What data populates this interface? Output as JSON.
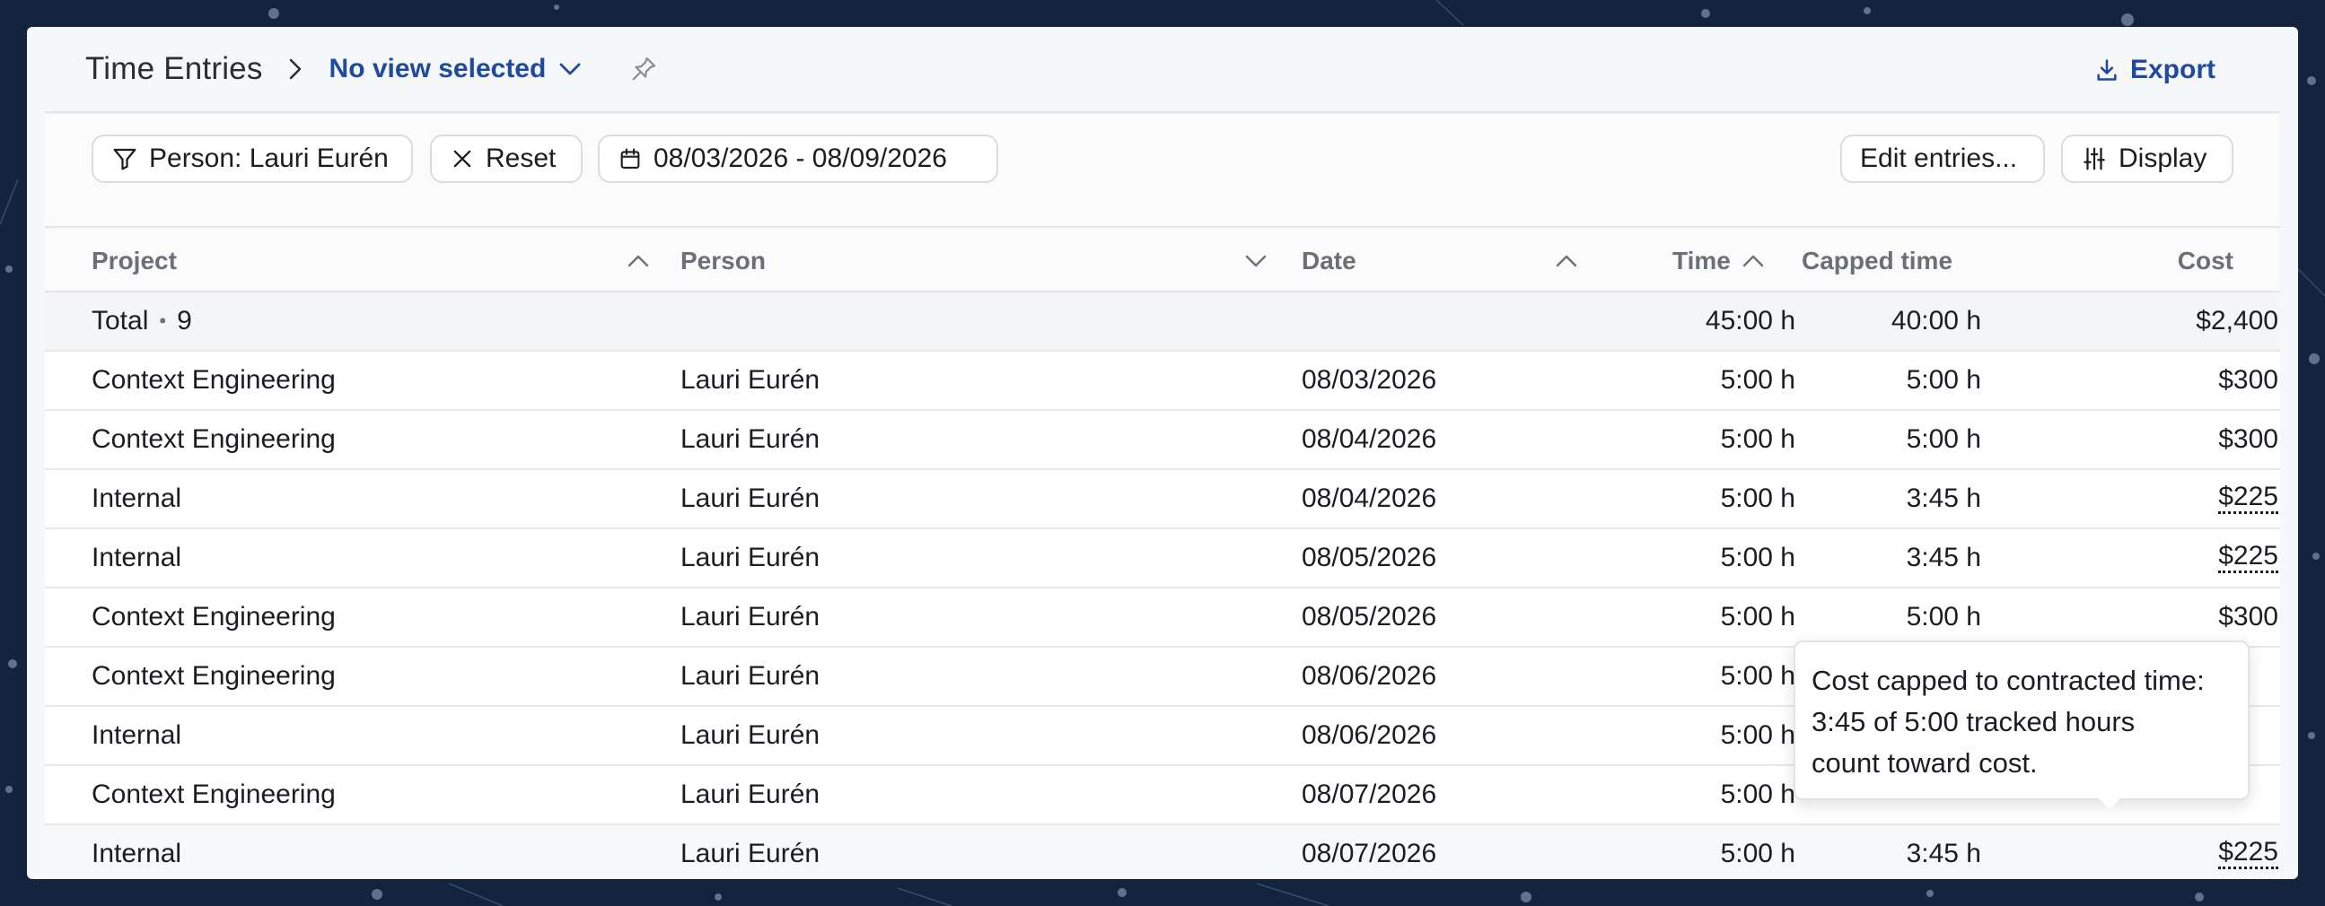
{
  "header": {
    "title": "Time Entries",
    "view_label": "No view selected",
    "export_label": "Export"
  },
  "filters": {
    "person_filter": "Person: Lauri Eurén",
    "reset_label": "Reset",
    "date_range": "08/03/2026 - 08/09/2026",
    "edit_entries_label": "Edit entries...",
    "display_label": "Display"
  },
  "columns": {
    "project": "Project",
    "person": "Person",
    "date": "Date",
    "time": "Time",
    "capped_time": "Capped time",
    "cost": "Cost"
  },
  "total": {
    "label": "Total",
    "count": "9",
    "time": "45:00 h",
    "capped_time": "40:00 h",
    "cost": "$2,400"
  },
  "rows": [
    {
      "project": "Context Engineering",
      "person": "Lauri Eurén",
      "date": "08/03/2026",
      "time": "5:00 h",
      "capped_time": "5:00 h",
      "cost": "$300"
    },
    {
      "project": "Context Engineering",
      "person": "Lauri Eurén",
      "date": "08/04/2026",
      "time": "5:00 h",
      "capped_time": "5:00 h",
      "cost": "$300"
    },
    {
      "project": "Internal",
      "person": "Lauri Eurén",
      "date": "08/04/2026",
      "time": "5:00 h",
      "capped_time": "3:45 h",
      "cost": "$225"
    },
    {
      "project": "Internal",
      "person": "Lauri Eurén",
      "date": "08/05/2026",
      "time": "5:00 h",
      "capped_time": "3:45 h",
      "cost": "$225"
    },
    {
      "project": "Context Engineering",
      "person": "Lauri Eurén",
      "date": "08/05/2026",
      "time": "5:00 h",
      "capped_time": "5:00 h",
      "cost": "$300"
    },
    {
      "project": "Context Engineering",
      "person": "Lauri Eurén",
      "date": "08/06/2026",
      "time": "5:00 h"
    },
    {
      "project": "Internal",
      "person": "Lauri Eurén",
      "date": "08/06/2026",
      "time": "5:00 h"
    },
    {
      "project": "Context Engineering",
      "person": "Lauri Eurén",
      "date": "08/07/2026",
      "time": "5:00 h"
    },
    {
      "project": "Internal",
      "person": "Lauri Eurén",
      "date": "08/07/2026",
      "time": "5:00 h",
      "capped_time": "3:45 h",
      "cost": "$225"
    }
  ],
  "tooltip": {
    "line1": "Cost capped to contracted time:",
    "line2": "3:45 of 5:00 tracked hours",
    "line3": "count toward cost."
  },
  "icons": {
    "filter": "filter-icon",
    "reset": "close-icon",
    "calendar": "calendar-icon",
    "display": "sliders-icon",
    "export": "download-icon",
    "pin": "pin-icon"
  },
  "colors": {
    "accent": "#1f4a9e",
    "background": "#14243d",
    "panel": "#f6f7f9"
  }
}
